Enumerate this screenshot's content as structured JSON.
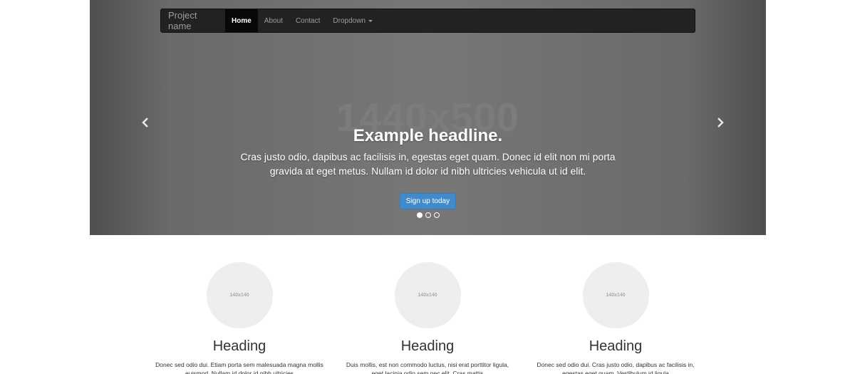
{
  "navbar": {
    "brand": "Project name",
    "items": [
      {
        "label": "Home",
        "active": true
      },
      {
        "label": "About",
        "active": false
      },
      {
        "label": "Contact",
        "active": false
      },
      {
        "label": "Dropdown",
        "active": false
      }
    ]
  },
  "carousel": {
    "placeholder": "1440x500",
    "headline": "Example headline.",
    "lead": "Cras justo odio, dapibus ac facilisis in, egestas eget quam. Donec id elit non mi porta gravida at eget metus. Nullam id dolor id nibh ultricies vehicula ut id elit.",
    "button_label": "Sign up today",
    "prev_icon": "chevron-left-icon",
    "next_icon": "chevron-right-icon",
    "slide_count": 3,
    "active_slide": 1
  },
  "columns": [
    {
      "image_label": "140x140",
      "heading": "Heading",
      "text": "Donec sed odio dui. Etiam porta sem malesuada magna mollis euismod. Nullam id dolor id nibh ultricies"
    },
    {
      "image_label": "140x140",
      "heading": "Heading",
      "text": "Duis mollis, est non commodo luctus, nisi erat porttitor ligula, eget lacinia odio sem nec elit. Cras mattis"
    },
    {
      "image_label": "140x140",
      "heading": "Heading",
      "text": "Donec sed odio dui. Cras justo odio, dapibus ac facilisis in, egestas eget quam. Vestibulum id ligula"
    }
  ],
  "colors": {
    "navbar_bg": "#222222",
    "navbar_active_bg": "#080808",
    "button_primary": "#428bca",
    "carousel_bg": "#777777"
  }
}
